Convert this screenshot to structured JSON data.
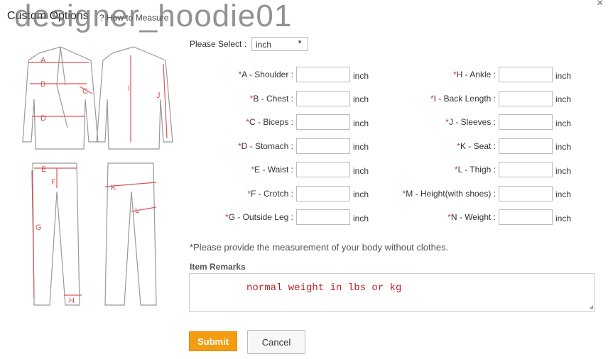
{
  "header": {
    "title": "Custom Options",
    "how_to": "How to Measure",
    "watermark": "designer_hoodie01",
    "close": "×"
  },
  "unit": {
    "label": "Please Select :",
    "value": "inch"
  },
  "fields_left": [
    {
      "label": "A - Shoulder :",
      "unit": "inch"
    },
    {
      "label": "B - Chest :",
      "unit": "inch"
    },
    {
      "label": "C - Biceps :",
      "unit": "inch"
    },
    {
      "label": "D - Stomach :",
      "unit": "inch"
    },
    {
      "label": "E - Waist :",
      "unit": "inch"
    },
    {
      "label": "F - Crotch :",
      "unit": "inch"
    },
    {
      "label": "G - Outside Leg :",
      "unit": "inch"
    }
  ],
  "fields_right": [
    {
      "label": "H - Ankle :",
      "unit": "inch"
    },
    {
      "label": "I - Back Length :",
      "unit": "inch"
    },
    {
      "label": "J - Sleeves :",
      "unit": "inch"
    },
    {
      "label": "K - Seat :",
      "unit": "inch"
    },
    {
      "label": "L - Thigh :",
      "unit": "inch"
    },
    {
      "label": "M - Height(with shoes) :",
      "unit": "inch"
    },
    {
      "label": "N - Weight :",
      "unit": "inch"
    }
  ],
  "required_mark": "*",
  "note": "*Please provide the measurement of your body without clothes.",
  "remarks": {
    "label": "Item Remarks",
    "value": "normal weight in lbs or kg"
  },
  "buttons": {
    "submit": "Submit",
    "cancel": "Cancel"
  },
  "diagram_letters": [
    "A",
    "B",
    "C",
    "D",
    "E",
    "F",
    "G",
    "H",
    "I",
    "J",
    "K",
    "L"
  ],
  "colors": {
    "accent": "#f39c12",
    "measure": "#d55555"
  }
}
